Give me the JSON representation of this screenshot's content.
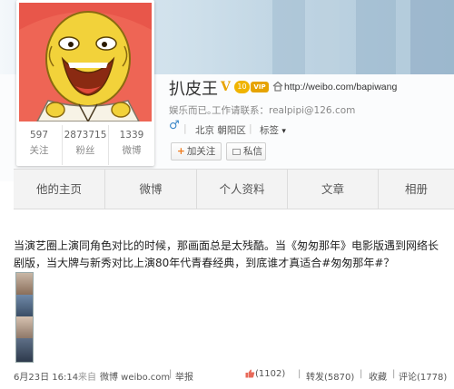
{
  "profile": {
    "name": "扒皮王",
    "v_badge": "V",
    "rank_badge": "10",
    "vip_badge": "VIP",
    "url": "http://weibo.com/bapiwang",
    "description": "娱乐而已。",
    "contact": "工作请联系：realpipi@126.com",
    "gender_symbol": "♂",
    "location": "北京 朝阳区",
    "tags_label": "标签",
    "tags_caret": "▾",
    "follow_label": "加关注",
    "follow_plus": "+",
    "message_label": "私信"
  },
  "stats": [
    {
      "value": "597",
      "label": "关注"
    },
    {
      "value": "2873715",
      "label": "粉丝"
    },
    {
      "value": "1339",
      "label": "微博"
    }
  ],
  "tabs": [
    "他的主页",
    "微博",
    "个人资料",
    "文章",
    "相册"
  ],
  "post": {
    "text": "当演艺圈上演同角色对比的时候，那画面总是太残酷。当《匆匆那年》电影版遇到网络长剧版，当大牌与新秀对比上演80年代青春经典，到底谁才真适合#匆匆那年#？",
    "date": "6月23日 16:14",
    "source_prefix": "来自",
    "source": "微博 weibo.com",
    "report": "举报",
    "likes": "(1102)",
    "repost": "转发(5870)",
    "favorite": "收藏",
    "comment": "评论(1778)",
    "divider": "|"
  },
  "colors": {
    "accent": "#3a87c8",
    "follow_orange": "#f07a1a",
    "badge_gold": "#e8a400",
    "avatar_bg": "#ee6555",
    "avatar_face": "#f2d23a"
  },
  "icons": [
    "home-icon",
    "envelope-icon",
    "thumb-up-icon"
  ]
}
